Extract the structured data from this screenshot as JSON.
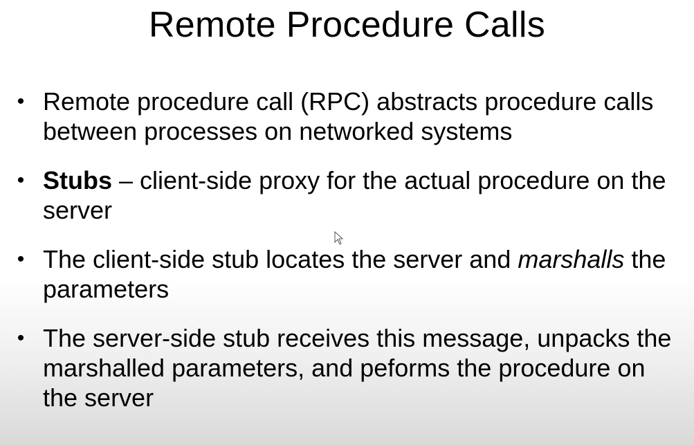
{
  "slide": {
    "title": "Remote Procedure Calls",
    "bullet_glyph": "•",
    "bullets": [
      {
        "text": "Remote procedure call (RPC) abstracts procedure calls between processes on networked systems"
      },
      {
        "term": "Stubs",
        "text": " – client-side proxy for the actual procedure on the server"
      },
      {
        "text_before": "The client-side stub locates the server and ",
        "emphasis": "marshalls",
        "text_after": " the parameters"
      },
      {
        "text": "The server-side stub receives this message, unpacks the marshalled parameters, and peforms the procedure on the server"
      }
    ]
  },
  "cursor": {
    "icon": "mouse-pointer-icon"
  }
}
